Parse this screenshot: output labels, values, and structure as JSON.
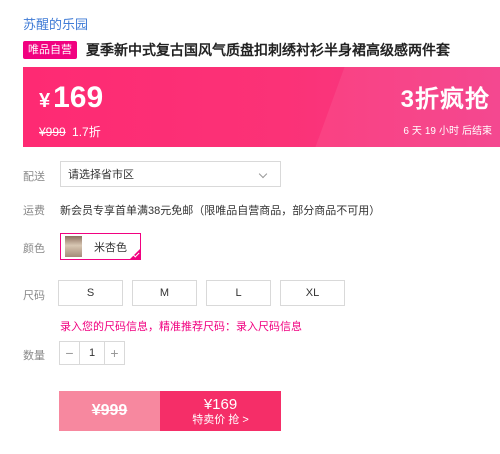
{
  "store": {
    "name": "苏醒的乐园"
  },
  "product": {
    "badge": "唯品自营",
    "title": "夏季新中式复古国风气质盘扣刺绣衬衫半身裙高级感两件套"
  },
  "price_banner": {
    "currency": "¥",
    "price": "169",
    "original_price": "¥999",
    "discount": "1.7折",
    "flash_title": "3折疯抢",
    "countdown": {
      "days": "6",
      "days_unit": "天",
      "hours": "19",
      "hours_unit": "小时",
      "suffix": "后结束"
    }
  },
  "delivery": {
    "label": "配送",
    "placeholder": "请选择省市区"
  },
  "freight": {
    "label": "运费",
    "text": "新会员专享首单满38元免邮（限唯品自营商品，部分商品不可用）"
  },
  "color": {
    "label": "颜色",
    "selected": "米杏色"
  },
  "size": {
    "label": "尺码",
    "options": [
      "S",
      "M",
      "L",
      "XL"
    ]
  },
  "size_tip": {
    "text": "录入您的尺码信息，精准推荐尺码：",
    "link": "录入尺码信息"
  },
  "quantity": {
    "label": "数量",
    "value": "1",
    "minus": "−",
    "plus": "+"
  },
  "buy_bar": {
    "original_price": "¥999",
    "price": "¥169",
    "label": "特卖价 抢 >"
  },
  "colors": {
    "brand_pink": "#f10180",
    "banner": "#fe2a73",
    "store_link": "#3f7bd6"
  }
}
